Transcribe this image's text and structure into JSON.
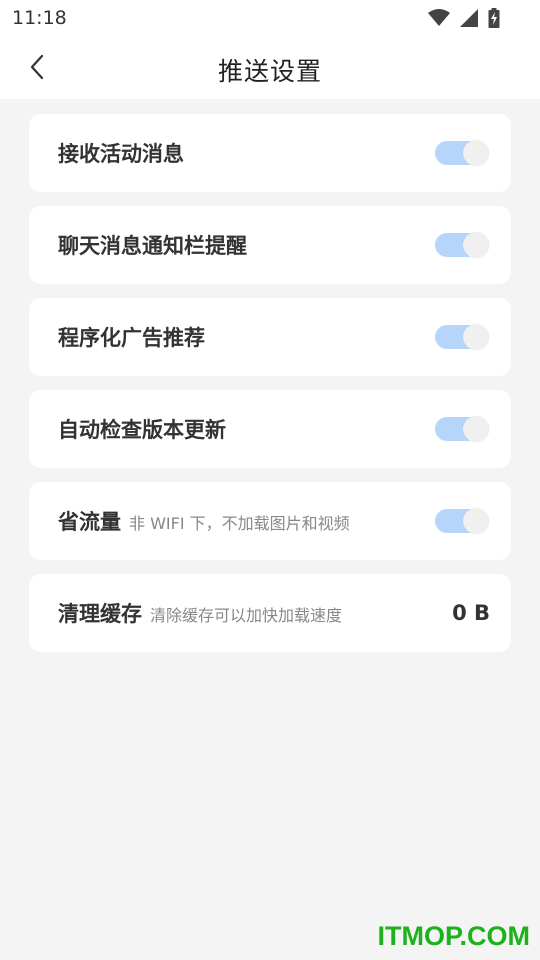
{
  "status_bar": {
    "time": "11:18",
    "icons": [
      "wifi-icon",
      "signal-icon",
      "battery-charging-icon"
    ]
  },
  "header": {
    "back_icon": "chevron-left-icon",
    "title": "推送设置"
  },
  "settings": [
    {
      "label": "接收活动消息",
      "desc": "",
      "enabled": true
    },
    {
      "label": "聊天消息通知栏提醒",
      "desc": "",
      "enabled": true
    },
    {
      "label": "程序化广告推荐",
      "desc": "",
      "enabled": true
    },
    {
      "label": "自动检查版本更新",
      "desc": "",
      "enabled": true
    },
    {
      "label": "省流量",
      "desc": "非 WIFI 下，不加载图片和视频",
      "enabled": true
    }
  ],
  "cache": {
    "label": "清理缓存",
    "desc": "清除缓存可以加快加载速度",
    "size": "0 B"
  },
  "watermark": "ITMOP.COM",
  "colors": {
    "toggle_on_track": "#b6d5fb",
    "toggle_knob": "#f0f0f0",
    "background": "#f4f4f4",
    "watermark": "#1db21d"
  }
}
